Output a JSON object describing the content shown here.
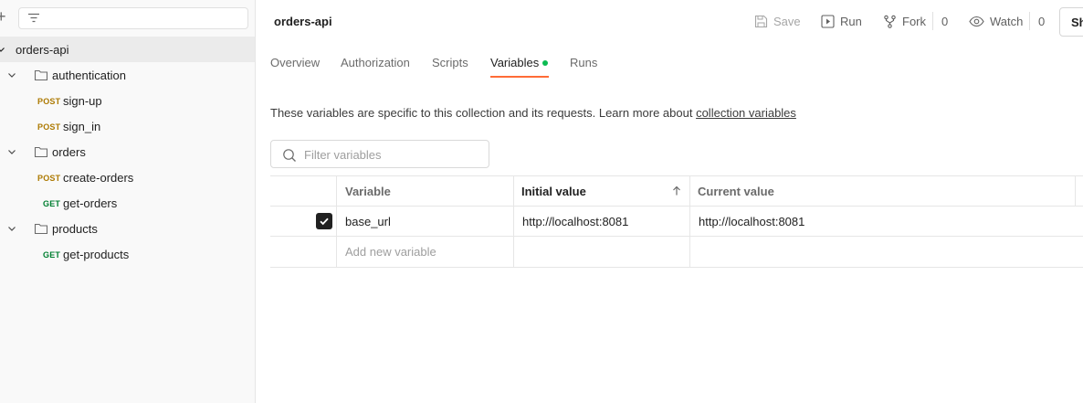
{
  "sidebar": {
    "filter_icon": "filter-icon",
    "root": {
      "label": "orders-api"
    },
    "folders": [
      {
        "label": "authentication",
        "requests": [
          {
            "method": "POST",
            "label": "sign-up"
          },
          {
            "method": "POST",
            "label": "sign_in"
          }
        ]
      },
      {
        "label": "orders",
        "requests": [
          {
            "method": "POST",
            "label": "create-orders"
          },
          {
            "method": "GET",
            "label": "get-orders"
          }
        ]
      },
      {
        "label": "products",
        "requests": [
          {
            "method": "GET",
            "label": "get-products"
          }
        ]
      }
    ]
  },
  "header": {
    "title": "orders-api",
    "save_label": "Save",
    "run_label": "Run",
    "fork_label": "Fork",
    "fork_count": "0",
    "watch_label": "Watch",
    "watch_count": "0",
    "share_label": "Sh"
  },
  "tabs": [
    {
      "label": "Overview"
    },
    {
      "label": "Authorization"
    },
    {
      "label": "Scripts"
    },
    {
      "label": "Variables",
      "active": true
    },
    {
      "label": "Runs"
    }
  ],
  "description": {
    "text": "These variables are specific to this collection and its requests. Learn more about ",
    "link": "collection variables"
  },
  "filter": {
    "placeholder": "Filter variables"
  },
  "table": {
    "columns": [
      "Variable",
      "Initial value",
      "Current value"
    ],
    "rows": [
      {
        "checked": true,
        "variable": "base_url",
        "initial": "http://localhost:8081",
        "current": "http://localhost:8081"
      }
    ],
    "new_row_placeholder": "Add new variable"
  },
  "colors": {
    "accent": "#ff6c37",
    "active_dot": "#0cbb52",
    "post": "#ad7a03",
    "get": "#007f31"
  }
}
